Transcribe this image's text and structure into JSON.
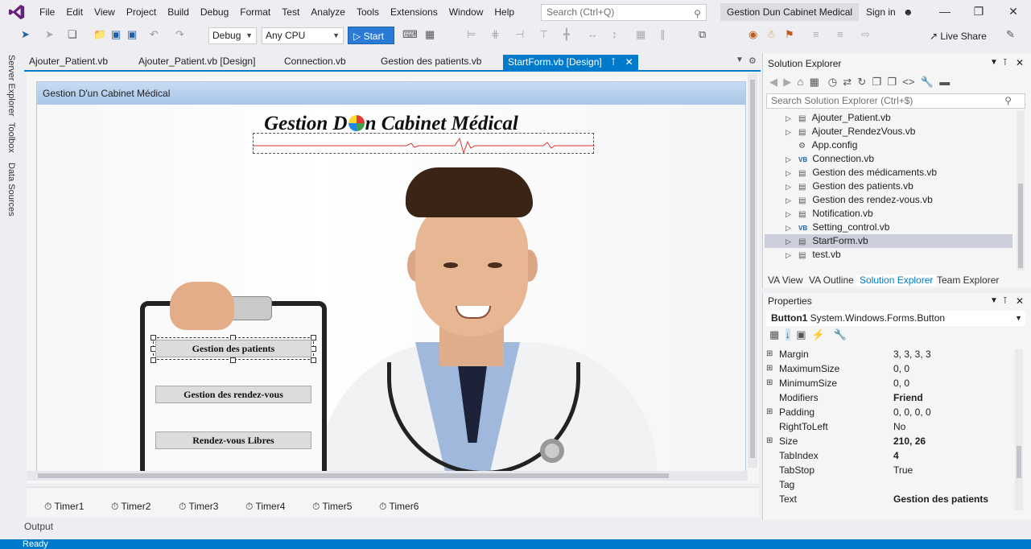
{
  "menu": {
    "items": [
      "File",
      "Edit",
      "View",
      "Project",
      "Build",
      "Debug",
      "Format",
      "Test",
      "Analyze",
      "Tools",
      "Extensions",
      "Window",
      "Help"
    ],
    "search_placeholder": "Search (Ctrl+Q)",
    "solution_title": "Gestion Dun Cabinet Medical",
    "signin": "Sign in"
  },
  "toolbar": {
    "config": "Debug",
    "platform": "Any CPU",
    "start_label": "Start",
    "live_share": "Live Share"
  },
  "side_tabs": [
    "Server Explorer",
    "Toolbox",
    "Data Sources"
  ],
  "doc_tabs": [
    {
      "label": "Ajouter_Patient.vb"
    },
    {
      "label": "Ajouter_Patient.vb [Design]"
    },
    {
      "label": "Connection.vb"
    },
    {
      "label": "Gestion des patients.vb"
    },
    {
      "label": "StartForm.vb [Design]"
    }
  ],
  "form": {
    "title": "Gestion D'un Cabinet Médical",
    "header_before": "Gestion D",
    "header_after": "n Cabinet Médical",
    "buttons": [
      "Gestion des patients",
      "Gestion des rendez-vous",
      "Rendez-vous Libres"
    ]
  },
  "tray": {
    "timers": [
      "Timer1",
      "Timer2",
      "Timer3",
      "Timer4",
      "Timer5",
      "Timer6"
    ]
  },
  "output_label": "Output",
  "status_text": "Ready",
  "solution_explorer": {
    "title": "Solution Explorer",
    "search_placeholder": "Search Solution Explorer (Ctrl+$)",
    "items": [
      {
        "label": "Ajouter_Patient.vb",
        "icon": "form-icon",
        "expandable": true
      },
      {
        "label": "Ajouter_RendezVous.vb",
        "icon": "form-icon",
        "expandable": true
      },
      {
        "label": "App.config",
        "icon": "config-icon",
        "expandable": false
      },
      {
        "label": "Connection.vb",
        "icon": "vb-icon",
        "expandable": true
      },
      {
        "label": "Gestion des médicaments.vb",
        "icon": "form-icon",
        "expandable": true
      },
      {
        "label": "Gestion des patients.vb",
        "icon": "form-icon",
        "expandable": true
      },
      {
        "label": "Gestion des rendez-vous.vb",
        "icon": "form-icon",
        "expandable": true
      },
      {
        "label": "Notification.vb",
        "icon": "form-icon",
        "expandable": true
      },
      {
        "label": "Setting_control.vb",
        "icon": "vb-icon",
        "expandable": true
      },
      {
        "label": "StartForm.vb",
        "icon": "form-icon",
        "expandable": true,
        "selected": true
      },
      {
        "label": "test.vb",
        "icon": "form-icon",
        "expandable": true
      }
    ],
    "tabs": [
      "VA View",
      "VA Outline",
      "Solution Explorer",
      "Team Explorer"
    ],
    "active_tab": "Solution Explorer"
  },
  "properties": {
    "title": "Properties",
    "object_name": "Button1",
    "object_type": "System.Windows.Forms.Button",
    "rows": [
      {
        "name": "Margin",
        "value": "3, 3, 3, 3",
        "expandable": true,
        "bold": false
      },
      {
        "name": "MaximumSize",
        "value": "0, 0",
        "expandable": true,
        "bold": false
      },
      {
        "name": "MinimumSize",
        "value": "0, 0",
        "expandable": true,
        "bold": false
      },
      {
        "name": "Modifiers",
        "value": "Friend",
        "expandable": false,
        "bold": true
      },
      {
        "name": "Padding",
        "value": "0, 0, 0, 0",
        "expandable": true,
        "bold": false
      },
      {
        "name": "RightToLeft",
        "value": "No",
        "expandable": false,
        "bold": false
      },
      {
        "name": "Size",
        "value": "210, 26",
        "expandable": true,
        "bold": true
      },
      {
        "name": "TabIndex",
        "value": "4",
        "expandable": false,
        "bold": true
      },
      {
        "name": "TabStop",
        "value": "True",
        "expandable": false,
        "bold": false
      },
      {
        "name": "Tag",
        "value": "",
        "expandable": false,
        "bold": false
      },
      {
        "name": "Text",
        "value": "Gestion des patients",
        "expandable": false,
        "bold": true
      }
    ]
  },
  "colors": {
    "accent": "#007acc",
    "selected_row": "#cccedb",
    "form_title_bar": "#a9c6e8"
  }
}
